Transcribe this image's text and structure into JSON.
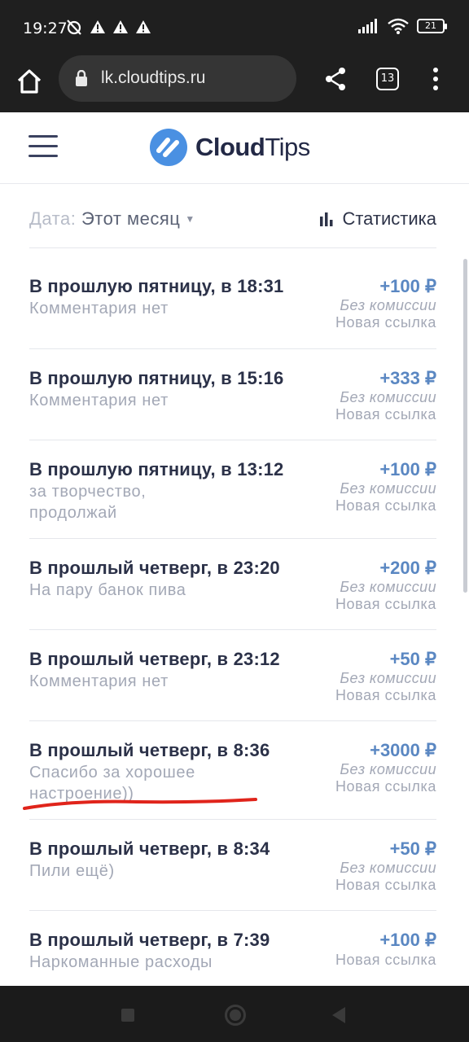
{
  "status_bar": {
    "time": "19:27",
    "battery": "21",
    "icons_left": [
      "alarm-off-icon",
      "warning-icon",
      "warning-icon",
      "warning-icon"
    ],
    "icons_right": [
      "signal-icon",
      "wifi-icon",
      "battery-icon"
    ]
  },
  "browser": {
    "url": "lk.cloudtips.ru",
    "tab_count": "13"
  },
  "app": {
    "logo_bold": "Cloud",
    "logo_light": "Tips",
    "brand_color": "#4a90e2"
  },
  "filter": {
    "date_label": "Дата:",
    "date_value": "Этот месяц",
    "stats_label": "Статистика"
  },
  "transactions": [
    {
      "title": "В прошлую пятницу, в 18:31",
      "comment": "Комментария нет",
      "amount": "+100 ₽",
      "fee": "Без комиссии",
      "source": "Новая ссылка"
    },
    {
      "title": "В прошлую пятницу, в 15:16",
      "comment": "Комментария нет",
      "amount": "+333 ₽",
      "fee": "Без комиссии",
      "source": "Новая ссылка"
    },
    {
      "title": "В прошлую пятницу, в 13:12",
      "comment": "за творчество, продолжай",
      "amount": "+100 ₽",
      "fee": "Без комиссии",
      "source": "Новая ссылка"
    },
    {
      "title": "В прошлый четверг, в 23:20",
      "comment": "На пару банок пива",
      "amount": "+200 ₽",
      "fee": "Без комиссии",
      "source": "Новая ссылка"
    },
    {
      "title": "В прошлый четверг, в 23:12",
      "comment": "Комментария нет",
      "amount": "+50 ₽",
      "fee": "Без комиссии",
      "source": "Новая ссылка"
    },
    {
      "title": "В прошлый четверг, в 8:36",
      "comment": "Спасибо за хорошее настроение))",
      "amount": "+3000 ₽",
      "fee": "Без комиссии",
      "source": "Новая ссылка"
    },
    {
      "title": "В прошлый четверг, в 8:34",
      "comment": "Пили ещё)",
      "amount": "+50 ₽",
      "fee": "Без комиссии",
      "source": "Новая ссылка"
    },
    {
      "title": "В прошлый четверг, в 7:39",
      "comment": "Наркоманные расходы",
      "amount": "+100 ₽",
      "fee": "",
      "source": "Новая ссылка"
    }
  ],
  "colors": {
    "amount": "#5a87c2",
    "annotation_underline": "#e0241b",
    "system_bar": "#1f1f1f"
  }
}
